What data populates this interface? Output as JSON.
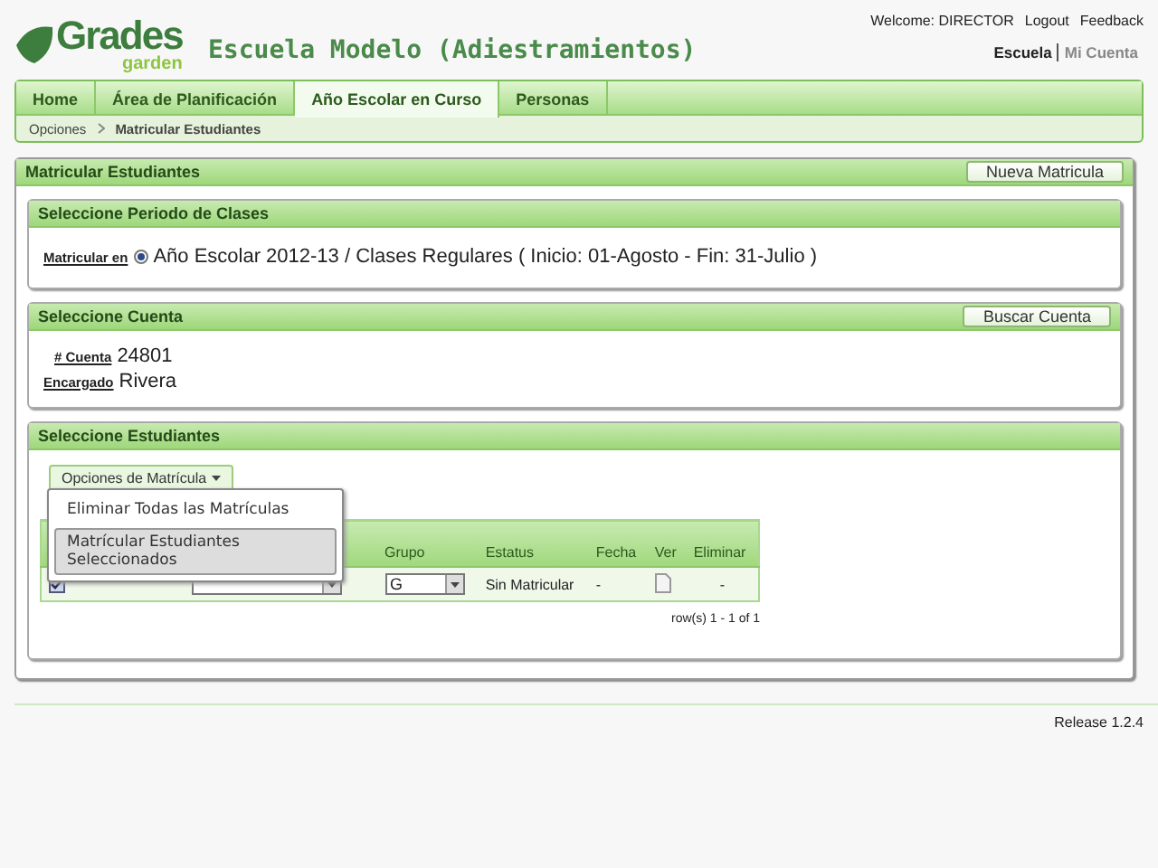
{
  "logo": {
    "word": "Grades",
    "sub": "garden"
  },
  "site_title": "Escuela Modelo (Adiestramientos)",
  "user_bar": {
    "welcome": "Welcome: DIRECTOR",
    "links": [
      "Logout",
      "Feedback"
    ]
  },
  "account_links": [
    {
      "label": "Escuela",
      "selected": true
    },
    {
      "label": "Mi Cuenta",
      "selected": false
    }
  ],
  "tabs": [
    {
      "label": "Home",
      "selected": false
    },
    {
      "label": "Área de Planificación",
      "selected": false
    },
    {
      "label": "Año Escolar en Curso",
      "selected": true
    },
    {
      "label": "Personas",
      "selected": false
    }
  ],
  "breadcrumb": [
    "Opciones",
    "Matricular Estudiantes"
  ],
  "panel": {
    "title": "Matricular Estudiantes",
    "button": "Nueva Matricula"
  },
  "periodo": {
    "title": "Seleccione Periodo de Clases",
    "label": "Matricular en",
    "option": "Año Escolar 2012-13 / Clases Regulares ( Inicio: 01-Agosto - Fin: 31-Julio )",
    "selected": true
  },
  "cuenta": {
    "title": "Seleccione Cuenta",
    "button": "Buscar Cuenta",
    "fields": [
      {
        "label": "# Cuenta",
        "value": "24801"
      },
      {
        "label": "Encargado",
        "value": "Rivera"
      }
    ]
  },
  "estudiantes": {
    "title": "Seleccione Estudiantes",
    "options_button": "Opciones de Matrícula",
    "menu": [
      {
        "label": "Eliminar Todas las Matrículas",
        "selected": false
      },
      {
        "label": "Matrícular Estudiantes Seleccionados",
        "selected": true
      }
    ],
    "columns": [
      "Grupo",
      "Estatus",
      "Fecha",
      "Ver",
      "Eliminar"
    ],
    "rows": [
      {
        "checked": true,
        "grupo": "G",
        "estatus": "Sin Matricular",
        "fecha": "-",
        "eliminar": "-"
      }
    ],
    "pager": "row(s) 1 - 1 of 1"
  },
  "footer": {
    "release": "Release 1.2.4"
  }
}
